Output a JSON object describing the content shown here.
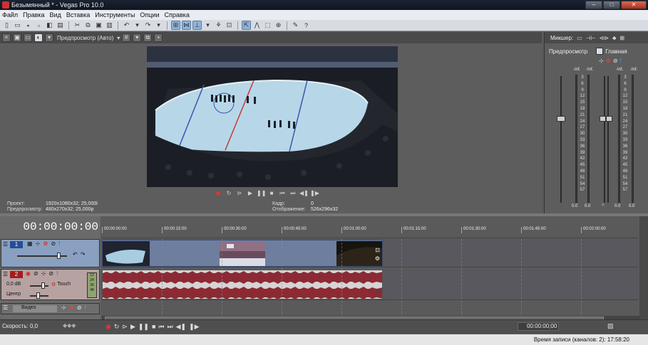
{
  "window": {
    "title": "Безымянный * - Vegas Pro 10.0"
  },
  "menu": [
    "Файл",
    "Правка",
    "Вид",
    "Вставка",
    "Инструменты",
    "Опции",
    "Справка"
  ],
  "preview": {
    "mode": "Предпросмотр (Авто)",
    "info": {
      "project_label": "Проект:",
      "project_value": "1920x1080x32; 25,000i",
      "preview_label": "Предпросмотр:",
      "preview_value": "480x270x32; 25,000p",
      "frame_label": "Кадр:",
      "frame_value": "0",
      "display_label": "Отображение:",
      "display_value": "526x296x32"
    }
  },
  "mixer": {
    "title": "Микшер:",
    "tab_preview": "Предпросмотр",
    "tab_main": "Главная",
    "inf_label": "-Inf.",
    "scale": [
      "3",
      "6",
      "9",
      "12",
      "15",
      "18",
      "21",
      "24",
      "27",
      "30",
      "33",
      "36",
      "39",
      "42",
      "45",
      "48",
      "51",
      "54",
      "57"
    ],
    "meter_values": [
      "0.0",
      "0.0",
      "0.0",
      "0.0"
    ]
  },
  "timeline": {
    "timecode": "00:00:00:00",
    "ruler": [
      "00:00:00:00",
      "00:00:15:00",
      "00:00:30:00",
      "00:00:45:00",
      "00:01:00:00",
      "00:01:15:00",
      "00:01:30:00",
      "00:01:45:00",
      "00:02:00:00"
    ],
    "video_track": {
      "number": "1"
    },
    "audio_track": {
      "number": "2",
      "volume": "0,0 dB",
      "automation": "Touch",
      "pan": "Центр",
      "meter_scale": [
        "12",
        "24",
        "36",
        "48"
      ]
    },
    "bus_track": {
      "label": "Видео"
    }
  },
  "bottom": {
    "rate_label": "Скорость: 0,0",
    "time": "00:00:00;00"
  },
  "status": {
    "text": "Время записи (каналов: 2): 17:58:20"
  },
  "colors": {
    "video_track": "#8aa0c0",
    "audio_track": "#b7a2a2",
    "waveform": "#8c2a33",
    "timecode": "#ffffff"
  }
}
